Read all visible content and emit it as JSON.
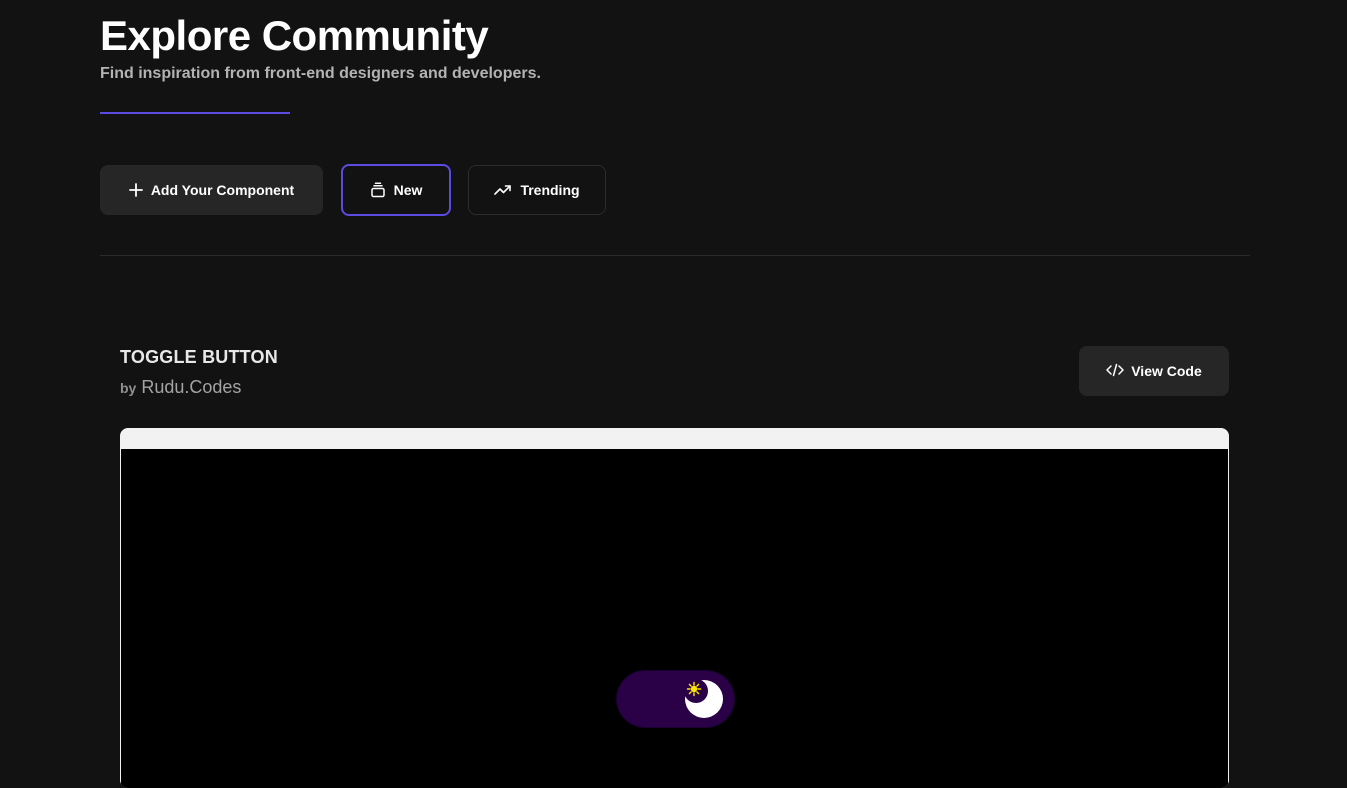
{
  "header": {
    "title": "Explore Community",
    "subtitle": "Find inspiration from front-end designers and developers."
  },
  "actions": {
    "add_component": {
      "label": "Add Your Component",
      "icon": "plus-icon"
    },
    "new": {
      "label": "New",
      "icon": "stack-icon",
      "selected": true
    },
    "trending": {
      "label": "Trending",
      "icon": "trending-up-icon"
    }
  },
  "card": {
    "title": "TOGGLE BUTTON",
    "by_label": "by",
    "author": "Rudu.Codes",
    "view_code_label": "View Code",
    "view_code_icon": "code-icon",
    "preview": {
      "toggle_state": "dark",
      "knob_icon": "moon-icon",
      "star_icon": "sun-icon"
    }
  },
  "colors": {
    "accent": "#5b4be0",
    "background": "#121212",
    "button_bg": "#262626",
    "toggle_bg": "#2a0046",
    "star": "#ffe600"
  }
}
